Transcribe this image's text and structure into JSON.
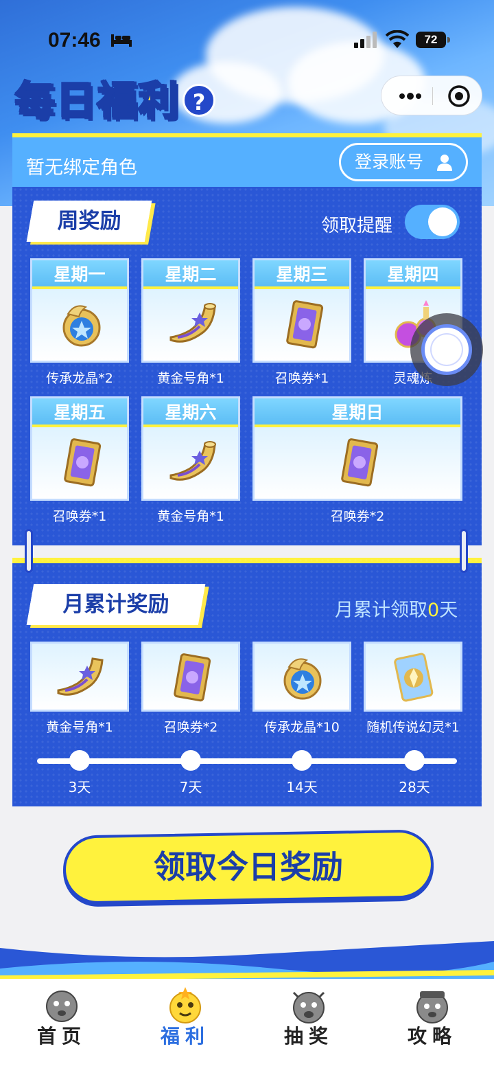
{
  "status_bar": {
    "time": "07:46",
    "battery": "72"
  },
  "header": {
    "title_part1": "每日",
    "title_part2": "福利",
    "help": "?"
  },
  "account": {
    "bind_text": "暂无绑定角色",
    "login_label": "登录账号"
  },
  "weekly": {
    "section_title": "周奖励",
    "reminder_label": "领取提醒",
    "reminder_on": true,
    "days": [
      {
        "day": "星期一",
        "reward": "传承龙晶*2",
        "icon": "dragon-crystal-icon"
      },
      {
        "day": "星期二",
        "reward": "黄金号角*1",
        "icon": "golden-horn-icon"
      },
      {
        "day": "星期三",
        "reward": "召唤券*1",
        "icon": "summon-ticket-icon"
      },
      {
        "day": "星期四",
        "reward": "灵魂炼",
        "icon": "soul-potion-icon"
      },
      {
        "day": "星期五",
        "reward": "召唤券*1",
        "icon": "summon-ticket-icon"
      },
      {
        "day": "星期六",
        "reward": "黄金号角*1",
        "icon": "golden-horn-icon"
      },
      {
        "day": "星期日",
        "reward": "召唤券*2",
        "icon": "summon-ticket-icon"
      }
    ]
  },
  "monthly": {
    "section_title": "月累计奖励",
    "count_prefix": "月累计领取",
    "count_value": "0",
    "count_suffix": "天",
    "rewards": [
      {
        "reward": "黄金号角*1",
        "milestone": "3天",
        "icon": "golden-horn-icon"
      },
      {
        "reward": "召唤券*2",
        "milestone": "7天",
        "icon": "summon-ticket-icon"
      },
      {
        "reward": "传承龙晶*10",
        "milestone": "14天",
        "icon": "dragon-crystal-icon"
      },
      {
        "reward": "随机传说幻灵*1",
        "milestone": "28天",
        "icon": "legend-spirit-card-icon"
      }
    ]
  },
  "claim_button": "领取今日奖励",
  "nav": [
    {
      "label": "首页",
      "icon": "home-mascot-icon",
      "active": false
    },
    {
      "label": "福利",
      "icon": "welfare-mascot-icon",
      "active": true
    },
    {
      "label": "抽奖",
      "icon": "lottery-mascot-icon",
      "active": false
    },
    {
      "label": "攻略",
      "icon": "guide-mascot-icon",
      "active": false
    }
  ],
  "colors": {
    "primary_blue": "#2a57d6",
    "accent_yellow": "#fff23d",
    "light_blue": "#55b0ff",
    "active_nav": "#2d6fe0"
  }
}
